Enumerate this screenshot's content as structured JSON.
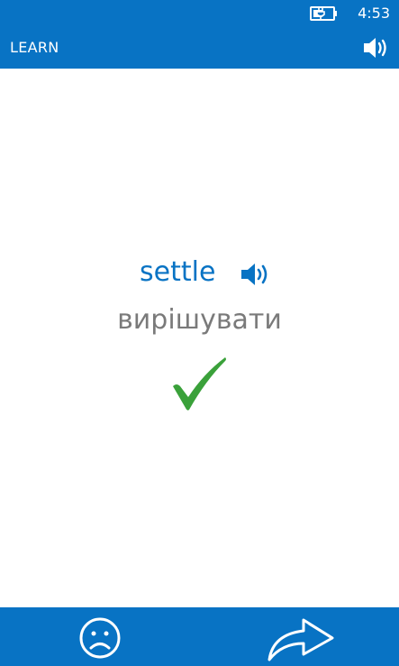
{
  "status_bar": {
    "time": "4:53",
    "battery_icon": "battery-charging-icon"
  },
  "app_bar": {
    "title": "LEARN",
    "speaker_icon": "speaker-icon"
  },
  "card": {
    "word": "settle",
    "translation": "вирішувати",
    "word_speaker_icon": "speaker-icon",
    "result_icon": "checkmark-icon"
  },
  "bottom_bar": {
    "sad_icon": "sad-face-icon",
    "next_icon": "forward-arrow-icon"
  },
  "colors": {
    "accent": "#0873c4",
    "word": "#0873c4",
    "translation": "#7a7a7a",
    "check": "#3aa13a",
    "bar_foreground": "#ffffff"
  }
}
